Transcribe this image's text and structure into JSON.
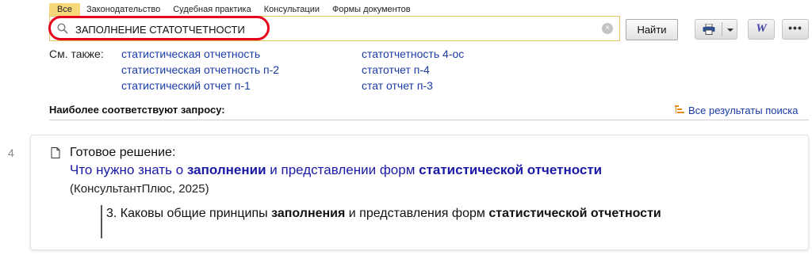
{
  "tabs": [
    {
      "label": "Все",
      "active": true
    },
    {
      "label": "Законодательство",
      "active": false
    },
    {
      "label": "Судебная практика",
      "active": false
    },
    {
      "label": "Консультации",
      "active": false
    },
    {
      "label": "Формы документов",
      "active": false
    }
  ],
  "search": {
    "value": "ЗАПОЛНЕНИЕ СТАТОТЧЕТНОСТИ",
    "clear_glyph": "×",
    "find_label": "Найти"
  },
  "toolbar": {
    "word_label": "W",
    "more_label": "•••",
    "icons": [
      "print-icon",
      "chevron-down-icon",
      "word-icon",
      "more-icon"
    ]
  },
  "see_also": {
    "label": "См. также:",
    "links": [
      "статистическая отчетность",
      "статистическая отчетность п-2",
      "статистический отчет п-1",
      "статотчетность 4-ос",
      "статотчет п-4",
      "стат отчет п-3"
    ]
  },
  "results_header": {
    "best_label": "Наиболее соответствуют запросу:",
    "all_results_label": "Все результаты поиска"
  },
  "result": {
    "number": "4",
    "type_label": "Готовое решение:",
    "title_parts": [
      "Что нужно знать о ",
      "заполнении",
      " и представлении форм ",
      "статистической отчетности"
    ],
    "source": "(КонсультантПлюс, 2025)",
    "quote_parts": [
      "3. Каковы общие принципы ",
      "заполнения",
      " и представления форм ",
      "статистической отчетности"
    ]
  },
  "colors": {
    "link": "#1a3aa8",
    "active_tab": "#f6d77a",
    "highlight_oval": "#e3001b",
    "accent_orange": "#e38a1e"
  }
}
